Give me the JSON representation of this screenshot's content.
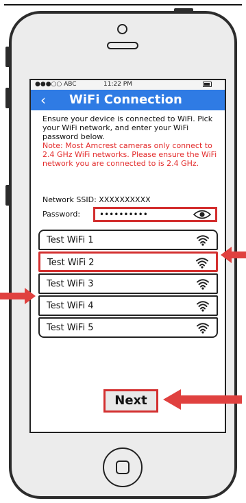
{
  "status_bar": {
    "carrier": "●●●○○ ABC",
    "time": "11:22 PM"
  },
  "nav": {
    "back_icon": "‹",
    "title": "WiFi Connection"
  },
  "instructions": {
    "intro": "Ensure your device is connected to WiFi. Pick your WiFi network, and enter your WiFi password below.",
    "note": "Note: Most Amcrest cameras only connect to 2.4 GHz WiFi networks. Please ensure the WiFi network you are connected to is 2.4 GHz."
  },
  "network": {
    "ssid_label": "Network SSID: XXXXXXXXXX",
    "password_label": "Password:",
    "password_value": "••••••••••"
  },
  "wifi_networks": [
    {
      "name": "Test WiFi 1",
      "selected": false
    },
    {
      "name": "Test WiFi 2",
      "selected": true
    },
    {
      "name": "Test WiFi 3",
      "selected": false
    },
    {
      "name": "Test WiFi 4",
      "selected": false
    },
    {
      "name": "Test WiFi 5",
      "selected": false
    }
  ],
  "next_button": "Next",
  "colors": {
    "nav_blue": "#2f7be4",
    "highlight_red": "#d32f2f",
    "note_red": "#e32b2b",
    "arrow_red": "#e0413f"
  }
}
